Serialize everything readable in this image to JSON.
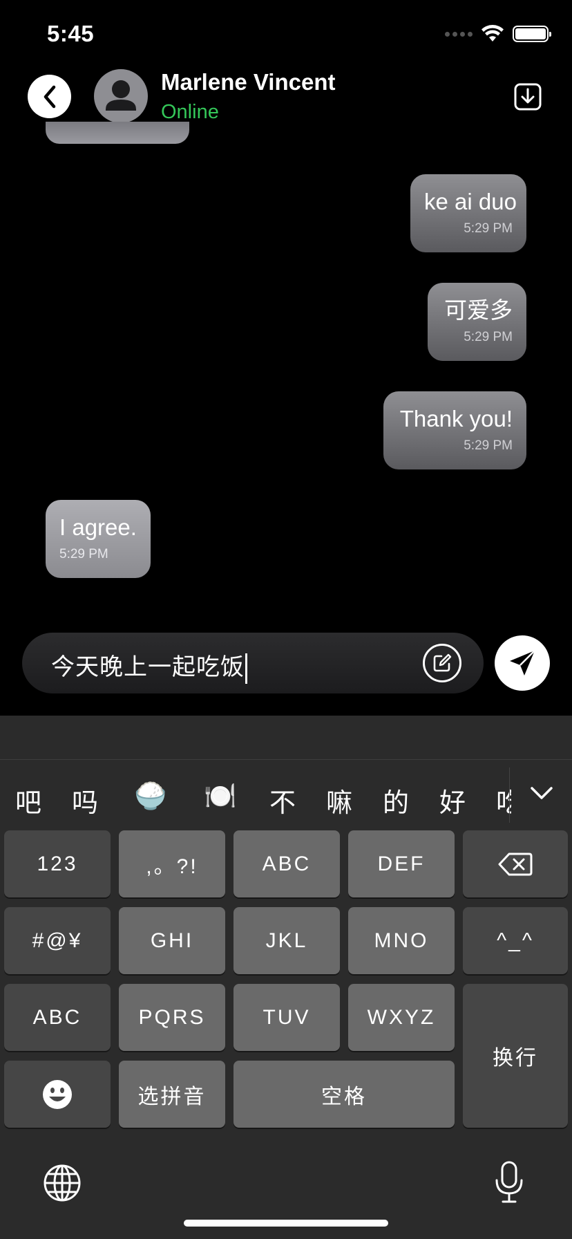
{
  "status_bar": {
    "time": "5:45"
  },
  "header": {
    "contact_name": "Marlene Vincent",
    "contact_status": "Online",
    "status_color": "#34c759",
    "back_icon": "chevron-left-icon",
    "download_icon": "download-icon"
  },
  "messages": [
    {
      "direction": "outgoing",
      "text": "ke ai duo",
      "time": "5:29 PM"
    },
    {
      "direction": "outgoing",
      "text": "可爱多",
      "time": "5:29 PM"
    },
    {
      "direction": "outgoing",
      "text": "Thank you!",
      "time": "5:29 PM"
    },
    {
      "direction": "incoming",
      "text": "I agree.",
      "time": "5:29 PM"
    }
  ],
  "composer": {
    "value": "今天晚上一起吃饭",
    "edit_icon": "edit-icon",
    "send_icon": "send-icon"
  },
  "keyboard": {
    "candidates": [
      "吧",
      "吗",
      "🍚",
      "🍽️",
      "不",
      "嘛",
      "的",
      "好",
      "吃"
    ],
    "keys": {
      "num": "123",
      "punct": ",。?!",
      "abc_key": "ABC",
      "def": "DEF",
      "symbols": "#@¥",
      "ghi": "GHI",
      "jkl": "JKL",
      "mno": "MNO",
      "kaomoji": "^_^",
      "abc_switch": "ABC",
      "pqrs": "PQRS",
      "tuv": "TUV",
      "wxyz": "WXYZ",
      "return": "换行",
      "pinyin": "选拼音",
      "space": "空格"
    }
  }
}
